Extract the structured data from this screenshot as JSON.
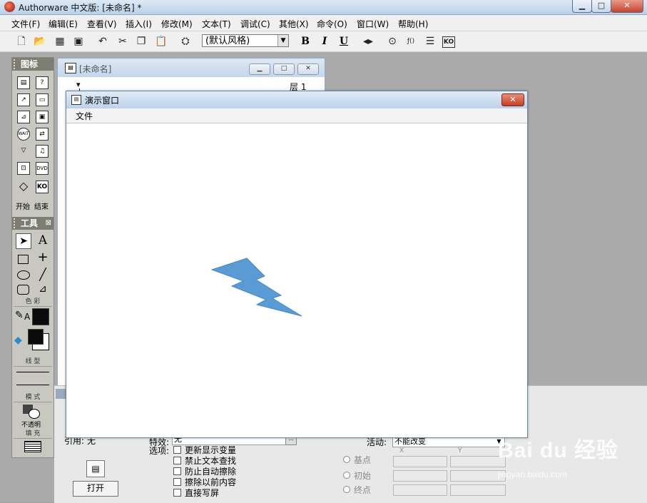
{
  "window": {
    "title": "Authorware 中文版: [未命名] *"
  },
  "menubar": [
    "文件(F)",
    "编辑(E)",
    "查看(V)",
    "插入(I)",
    "修改(M)",
    "文本(T)",
    "调试(C)",
    "其他(X)",
    "命令(O)",
    "窗口(W)",
    "帮助(H)"
  ],
  "toolbar": {
    "style_select": "(默认风格)",
    "bold_label": "B",
    "italic_label": "I",
    "underline_label": "U",
    "ko_label": "KO"
  },
  "palette": {
    "icons_title": "图标",
    "wait_label": "WAIT",
    "dvd_label": "DVD",
    "ko_label": "KO",
    "start_label": "开始",
    "end_label": "结束",
    "tools_title": "工具",
    "text_tool_label": "A",
    "color_label": "色 彩",
    "text_color_label": "A",
    "line_label": "线 型",
    "mode_label": "模 式",
    "mode_value": "不透明",
    "fill_label": "填 充"
  },
  "flow_window": {
    "title": "[未命名]",
    "layer_label": "层 1"
  },
  "presentation_window": {
    "title": "演示窗口",
    "menu_file": "文件"
  },
  "properties": {
    "ref_label": "引用:",
    "ref_value": "无",
    "effect_label": "特效:",
    "effect_value": "无",
    "options_label": "选项:",
    "options": [
      "更新显示变量",
      "禁止文本查找",
      "防止自动擦除",
      "擦除以前内容",
      "直接写屏"
    ],
    "activity_label": "活动:",
    "activity_value": "不能改变",
    "col_x": "X",
    "col_y": "Y",
    "positions": [
      "基点",
      "初始",
      "终点"
    ],
    "open_button": "打开"
  },
  "watermark": {
    "brand": "Bai du 经验",
    "url": "jingyan.baidu.com"
  },
  "colors": {
    "shape_fill": "#5b9bd5",
    "titlebar": "#c4d7ec",
    "palette_header": "#7d7d74"
  }
}
